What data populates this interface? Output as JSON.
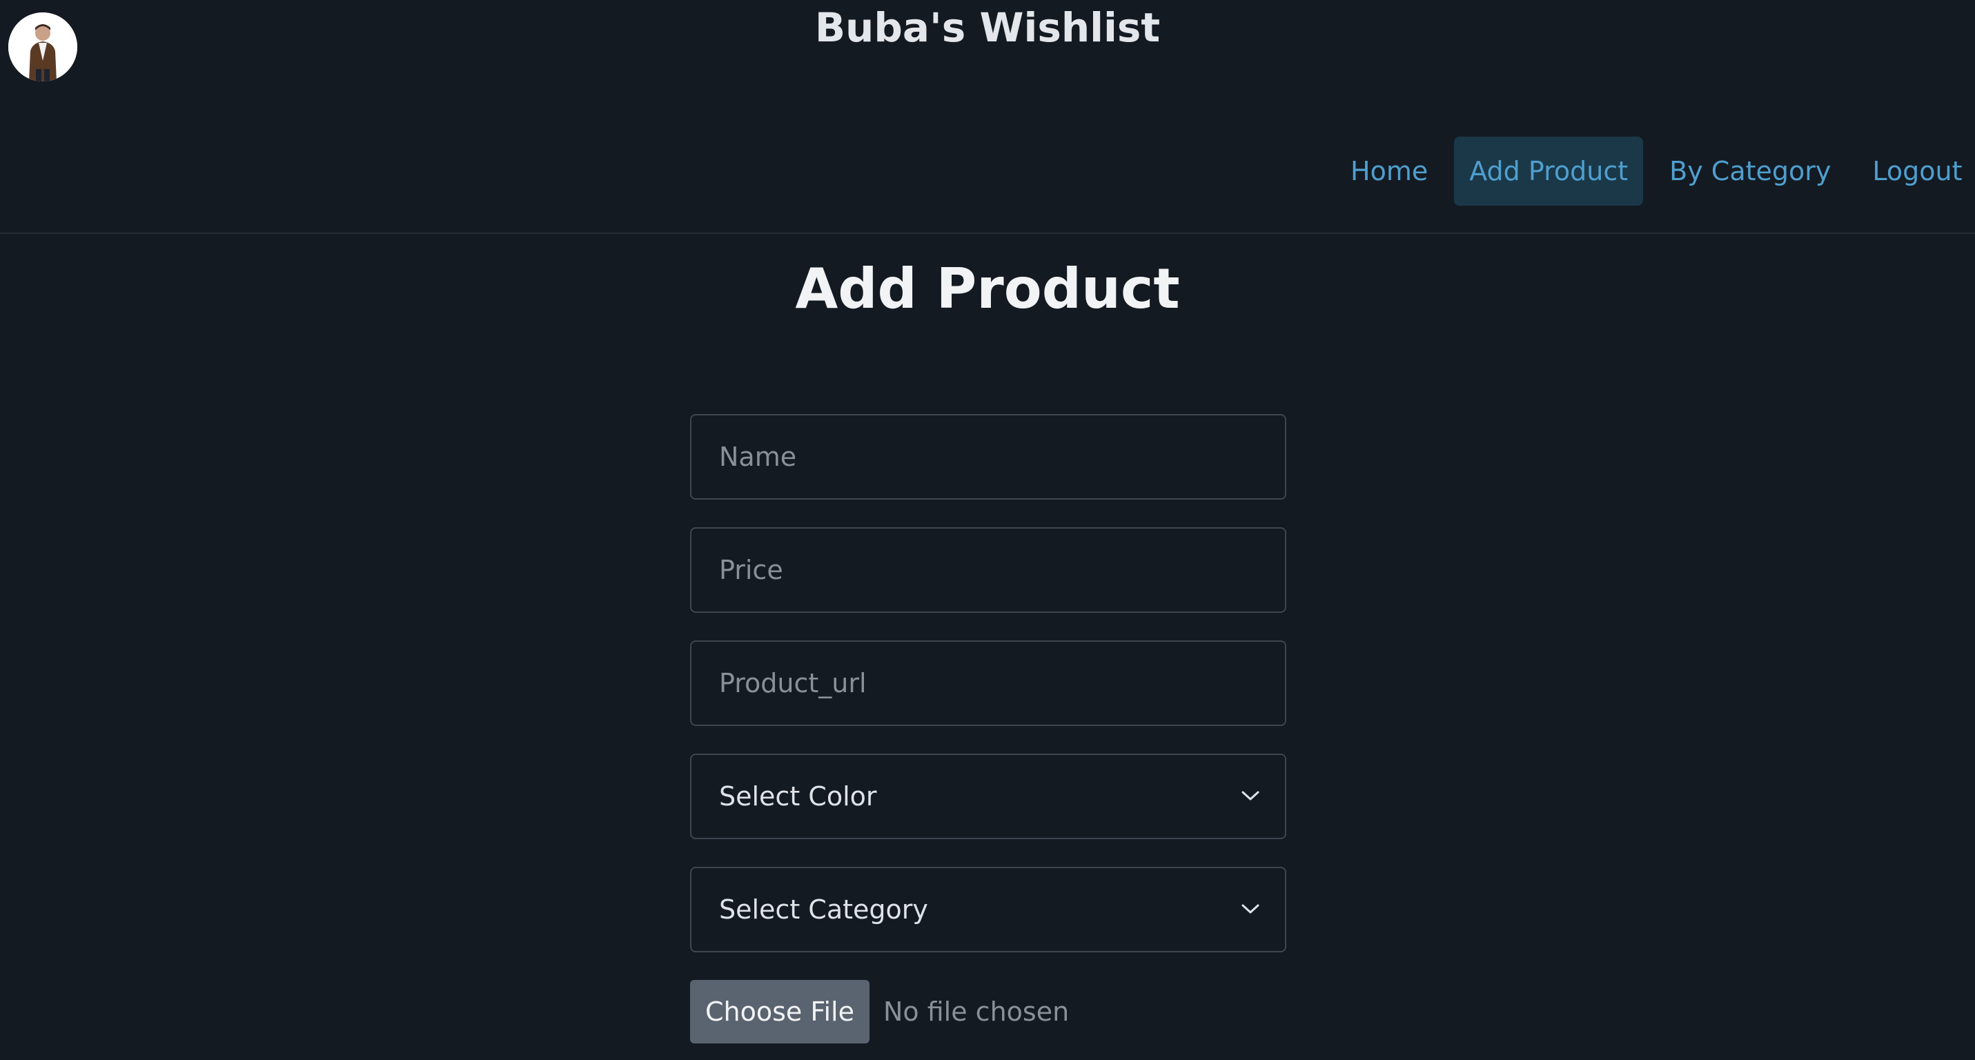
{
  "header": {
    "site_title": "Buba's Wishlist"
  },
  "nav": {
    "items": [
      {
        "label": "Home",
        "active": false
      },
      {
        "label": "Add Product",
        "active": true
      },
      {
        "label": "By Category",
        "active": false
      },
      {
        "label": "Logout",
        "active": false
      }
    ]
  },
  "main": {
    "page_title": "Add Product"
  },
  "form": {
    "name": {
      "placeholder": "Name",
      "value": ""
    },
    "price": {
      "placeholder": "Price",
      "value": ""
    },
    "product_url": {
      "placeholder": "Product_url",
      "value": ""
    },
    "color_select": {
      "selected": "Select Color"
    },
    "category_select": {
      "selected": "Select Category"
    },
    "file": {
      "button_label": "Choose File",
      "status": "No file chosen"
    }
  },
  "colors": {
    "background": "#141a22",
    "link": "#4f9fcf",
    "active_nav_bg": "#1b3848",
    "field_border": "#3e4650",
    "file_button_bg": "#5a6470"
  },
  "icons": {
    "avatar": "user-photo",
    "select_arrow": "chevron-down-icon"
  }
}
